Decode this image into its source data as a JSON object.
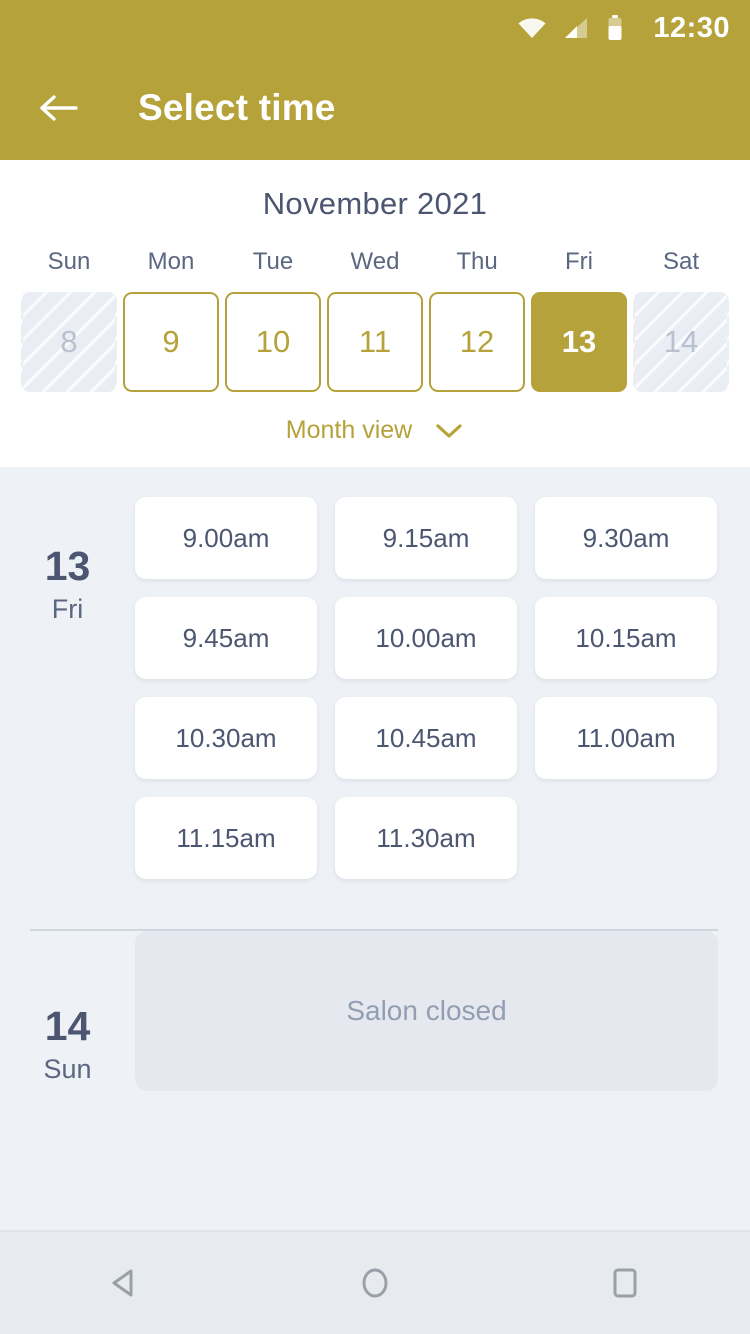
{
  "statusbar": {
    "time": "12:30",
    "icons": [
      "wifi-icon",
      "signal-icon",
      "battery-icon"
    ]
  },
  "appbar": {
    "title": "Select time",
    "back_icon": "arrow-left-icon"
  },
  "calendar": {
    "month_label": "November 2021",
    "weekdays": [
      "Sun",
      "Mon",
      "Tue",
      "Wed",
      "Thu",
      "Fri",
      "Sat"
    ],
    "days": [
      {
        "num": "8",
        "state": "disabled"
      },
      {
        "num": "9",
        "state": "available"
      },
      {
        "num": "10",
        "state": "available"
      },
      {
        "num": "11",
        "state": "available"
      },
      {
        "num": "12",
        "state": "available"
      },
      {
        "num": "13",
        "state": "selected"
      },
      {
        "num": "14",
        "state": "disabled"
      }
    ],
    "month_view_label": "Month view",
    "month_view_icon": "chevron-down-icon"
  },
  "schedule": [
    {
      "day_number": "13",
      "day_of_week": "Fri",
      "slots": [
        "9.00am",
        "9.15am",
        "9.30am",
        "9.45am",
        "10.00am",
        "10.15am",
        "10.30am",
        "10.45am",
        "11.00am",
        "11.15am",
        "11.30am"
      ]
    },
    {
      "day_number": "14",
      "day_of_week": "Sun",
      "closed_message": "Salon closed"
    }
  ],
  "navbar": {
    "back_icon": "triangle-back-icon",
    "home_icon": "circle-home-icon",
    "recents_icon": "square-recents-icon"
  },
  "colors": {
    "brand_gold": "#b5a23a",
    "surface": "#eef1f6",
    "text_slate": "#4c5670",
    "disabled_grey": "#b9c0ce"
  }
}
